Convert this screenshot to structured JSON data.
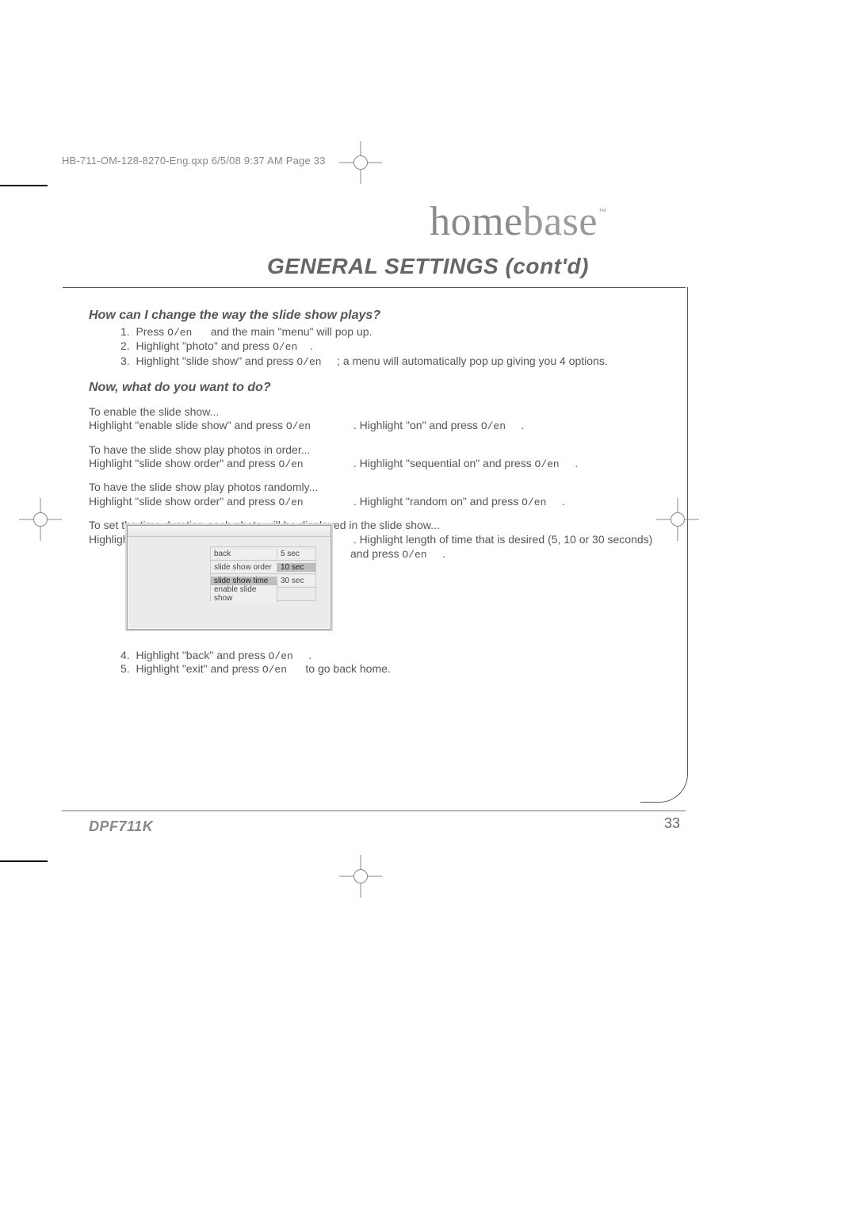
{
  "print_header": "HB-711-OM-128-8270-Eng.qxp  6/5/08  9:37 AM  Page 33",
  "brand": {
    "part1": "home",
    "part2": "base"
  },
  "tm": "™",
  "section_title": "GENERAL SETTINGS (cont'd)",
  "q1": "How can I change the way the slide show plays?",
  "steps1": {
    "n1": "1.",
    "t1a": "Press ",
    "k": "O/en",
    "t1b": " and the main \"menu\" will pop up.",
    "n2": "2.",
    "t2a": "Highlight \"photo\" and press ",
    "t2b": ".",
    "n3": "3.",
    "t3a": "Highlight \"slide show\" and press ",
    "t3b": "; a menu will automatically pop up giving you 4 options."
  },
  "sub": "Now, what do you want to do?",
  "p1": {
    "a": "To enable the slide show...",
    "b1": "Highlight \"enable slide show\" and press ",
    "b2": ". Highlight \"on\" and press ",
    "b3": "."
  },
  "p2": {
    "a": "To have the slide show play photos in order...",
    "b1": "Highlight \"slide show order\" and press ",
    "b2": ". Highlight \"sequential on\" and press ",
    "b3": "."
  },
  "p3": {
    "a": "To have the slide show play photos randomly...",
    "b1": "Highlight \"slide show order\" and press ",
    "b2": ". Highlight \"random on\" and press ",
    "b3": "."
  },
  "p4": {
    "a": "To set the time duration each photo will be displayed in the slide show...",
    "b1": "Highlight \"slide show time\" and press ",
    "b2": ". Highlight length of time that is desired (5, 10 or 30 seconds)",
    "b3": "and press ",
    "b4": "."
  },
  "menu": {
    "rows": [
      {
        "l": "back",
        "r": "5 sec",
        "sel": false
      },
      {
        "l": "slide show order",
        "r": "10 sec",
        "sel": true
      },
      {
        "l": "slide show time",
        "r": "30 sec",
        "sel": false,
        "lsel": true
      },
      {
        "l": "enable slide show",
        "r": "",
        "sel": false
      }
    ]
  },
  "steps2": {
    "n4": "4.",
    "t4a": "Highlight \"back\" and press ",
    "t4b": ".",
    "n5": "5.",
    "t5a": "Highlight \"exit\" and press ",
    "t5b": " to go back home."
  },
  "model": "DPF711K",
  "page_number": "33"
}
